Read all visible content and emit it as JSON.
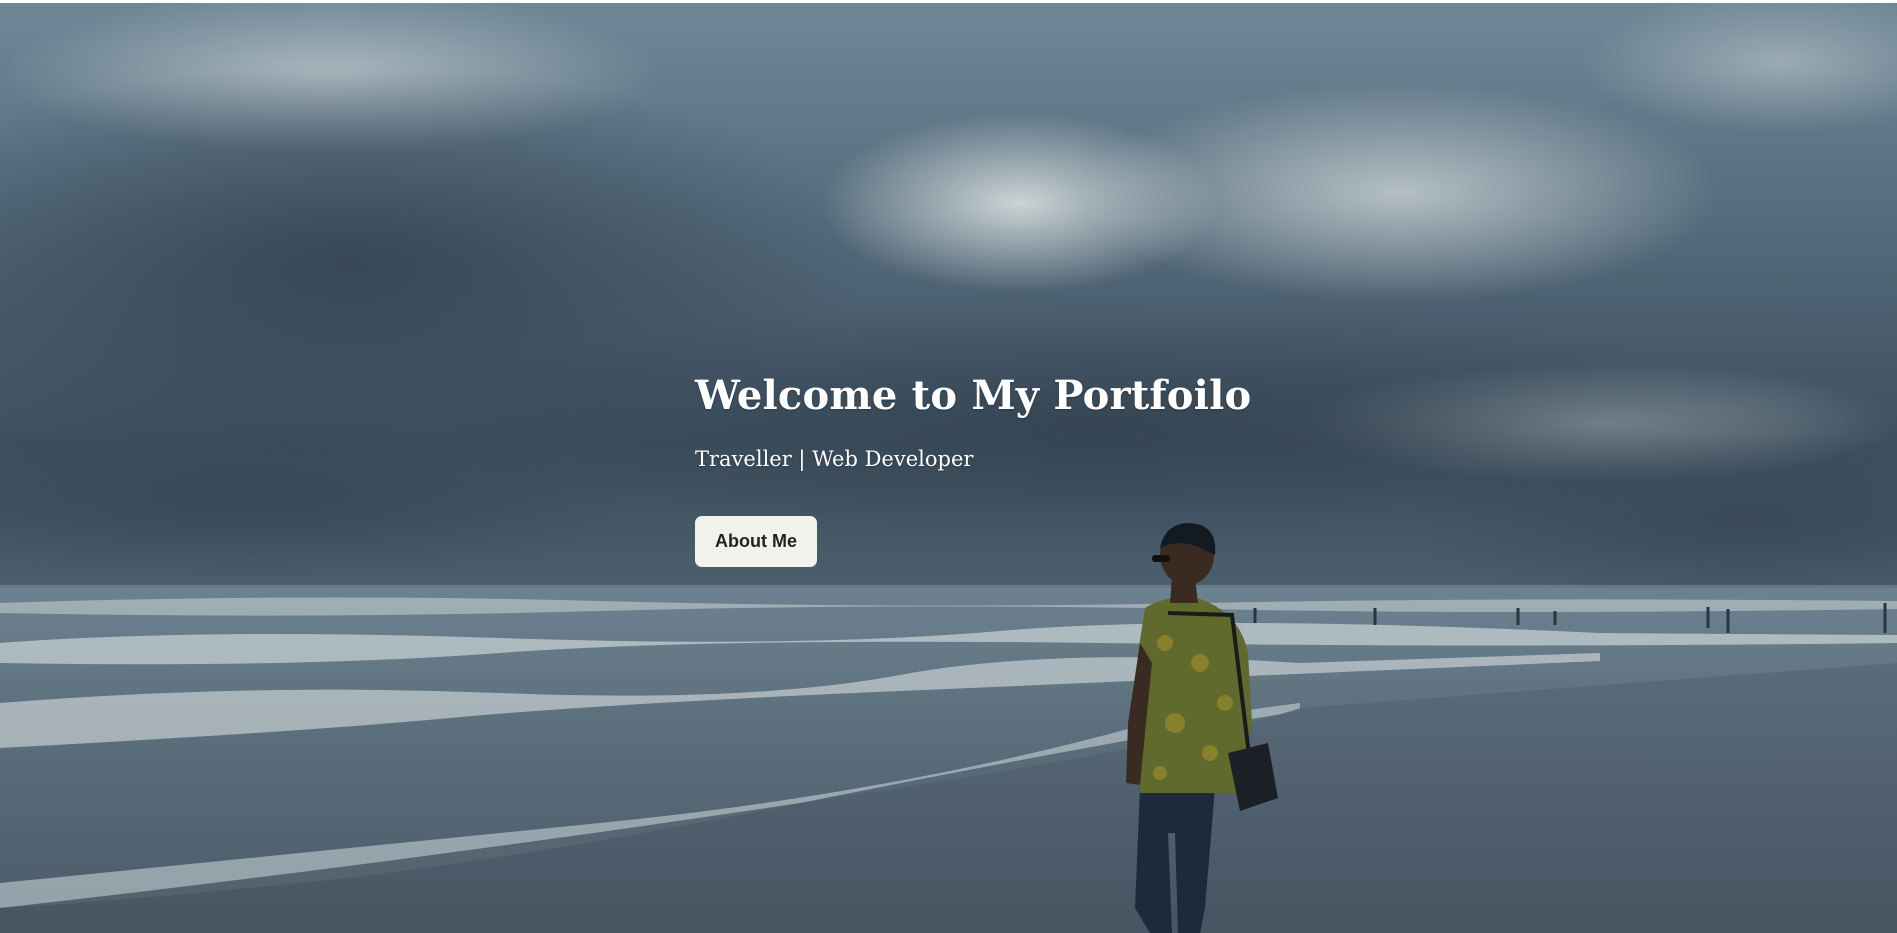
{
  "hero": {
    "title": "Welcome to My Portfoilo",
    "subtitle": "Traveller | Web Developer",
    "button_label": "About Me",
    "background_photo": "person-standing-on-beach-under-cloudy-sky"
  },
  "colors": {
    "button_background": "#f2f2ed",
    "button_text": "#1f2226",
    "text": "#ffffff"
  }
}
